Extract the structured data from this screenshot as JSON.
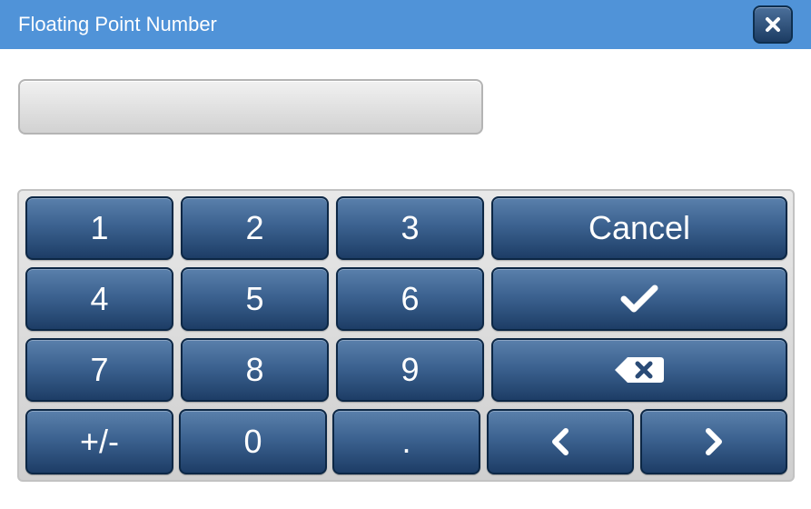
{
  "window": {
    "title": "Floating Point Number",
    "close_icon": "close-icon"
  },
  "input": {
    "value": ""
  },
  "keypad": {
    "key_1": "1",
    "key_2": "2",
    "key_3": "3",
    "key_4": "4",
    "key_5": "5",
    "key_6": "6",
    "key_7": "7",
    "key_8": "8",
    "key_9": "9",
    "key_0": "0",
    "key_sign": "+/-",
    "key_decimal": ".",
    "cancel": "Cancel",
    "confirm_icon": "checkmark-icon",
    "backspace_icon": "backspace-icon",
    "left_icon": "chevron-left-icon",
    "right_icon": "chevron-right-icon"
  },
  "colors": {
    "titlebar": "#5093d8",
    "key_top": "#5a80ab",
    "key_bottom": "#1d3d66",
    "key_border": "#0c2745",
    "keypad_background": "#dcdcdc"
  }
}
